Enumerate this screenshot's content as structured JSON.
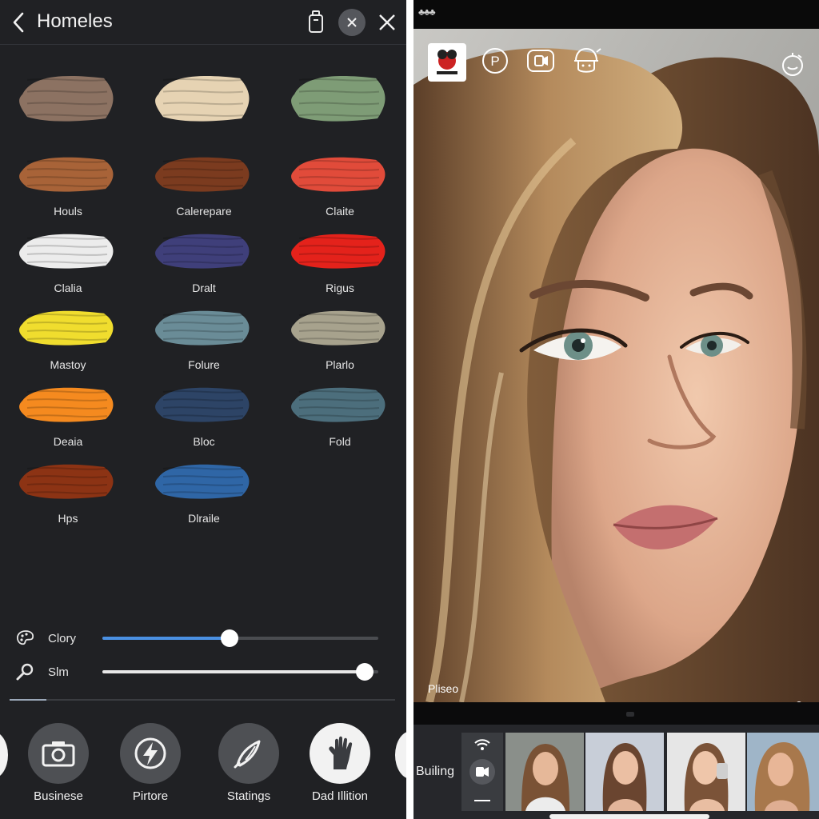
{
  "header": {
    "title": "Homeles"
  },
  "swatches": [
    {
      "label": "",
      "color": "#8c7262"
    },
    {
      "label": "",
      "color": "#e6d3b3"
    },
    {
      "label": "",
      "color": "#7e9c76"
    },
    {
      "label": "Houls",
      "color": "#a86338"
    },
    {
      "label": "Calerepare",
      "color": "#7b3b1f"
    },
    {
      "label": "Claite",
      "color": "#e14b3a"
    },
    {
      "label": "Clalia",
      "color": "#ececec"
    },
    {
      "label": "Dralt",
      "color": "#3f3f7a"
    },
    {
      "label": "Rigus",
      "color": "#e4221b"
    },
    {
      "label": "Mastoy",
      "color": "#f0dd2e"
    },
    {
      "label": "Folure",
      "color": "#6a8c97"
    },
    {
      "label": "Plarlo",
      "color": "#a7a28d"
    },
    {
      "label": "Deaia",
      "color": "#f58a1f"
    },
    {
      "label": "Bloc",
      "color": "#2d4466"
    },
    {
      "label": "Fold",
      "color": "#4c6e7c"
    },
    {
      "label": "Hps",
      "color": "#8c3314"
    },
    {
      "label": "Dlraile",
      "color": "#2f66a6"
    }
  ],
  "sliders": [
    {
      "label": "Clory",
      "value": 0.46,
      "fill_color": "#4a90e2",
      "icon": "palette-icon"
    },
    {
      "label": "Slm",
      "value": 0.95,
      "fill_color": "#e8e8e8",
      "icon": "magnifier-icon"
    }
  ],
  "tools": [
    {
      "label": "Businese",
      "icon": "camera-icon"
    },
    {
      "label": "Pirtore",
      "icon": "lightning-icon"
    },
    {
      "label": "Statings",
      "icon": "brush-icon"
    },
    {
      "label": "Dad Illition",
      "icon": "hand-icon"
    }
  ],
  "preview": {
    "video_label": "Pliseo",
    "progress": 0.24,
    "buffered": 0.69,
    "overlay_icons": [
      "mask-sticker-icon",
      "p-badge-icon",
      "video-camera-icon",
      "face-helmet-icon",
      "timer-icon"
    ]
  },
  "filmstrip": {
    "label": "Builing",
    "thumbnail_count": 4
  },
  "colors": {
    "panel_bg": "#202124",
    "accent": "#4a90e2"
  }
}
